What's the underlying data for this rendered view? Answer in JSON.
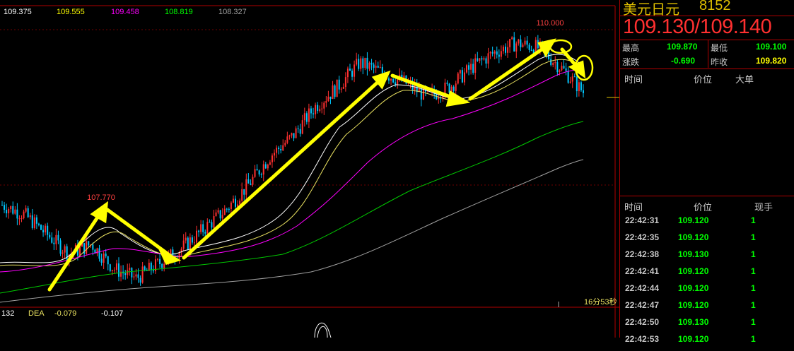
{
  "ma_values": [
    {
      "value": "109.375",
      "color": "#ffffff"
    },
    {
      "value": "109.555",
      "color": "#ffff00"
    },
    {
      "value": "109.458",
      "color": "#ff00ff"
    },
    {
      "value": "108.819",
      "color": "#00ff00"
    },
    {
      "value": "108.327",
      "color": "#a0a0a0"
    }
  ],
  "chart_data": {
    "type": "candlestick",
    "annotations": [
      {
        "label": "107.770",
        "kind": "high-marker"
      },
      {
        "label": "110.000",
        "kind": "high-marker"
      }
    ],
    "price_path": [
      108.35,
      108.25,
      108.05,
      107.85,
      107.95,
      107.7,
      107.6,
      107.75,
      107.9,
      108.1,
      108.3,
      108.55,
      108.85,
      109.05,
      109.35,
      109.55,
      109.8,
      109.7,
      109.6,
      109.45,
      109.55,
      109.75,
      109.9,
      110.0,
      109.95,
      109.75,
      109.5
    ],
    "colors": {
      "up": "#ff3030",
      "down": "#00c8ff",
      "arrow": "#ffff00"
    },
    "timer_label": "16分53秒"
  },
  "macd": {
    "first": "132",
    "dea_label": "DEA",
    "dea_value": "-0.079",
    "third": "-0.107"
  },
  "quote": {
    "name": "美元日元",
    "code": "8152",
    "price": "109.130/109.140",
    "high_label": "最高",
    "high": "109.870",
    "low_label": "最低",
    "low": "109.100",
    "change_label": "涨跌",
    "change": "-0.690",
    "prev_label": "昨收",
    "prev": "109.820"
  },
  "big_orders": {
    "col_time": "时间",
    "col_price": "价位",
    "col_big": "大单"
  },
  "trades": {
    "col_time": "时间",
    "col_price": "价位",
    "col_vol": "现手",
    "rows": [
      {
        "time": "22:42:31",
        "price": "109.120",
        "vol": "1"
      },
      {
        "time": "22:42:35",
        "price": "109.120",
        "vol": "1"
      },
      {
        "time": "22:42:38",
        "price": "109.130",
        "vol": "1"
      },
      {
        "time": "22:42:41",
        "price": "109.120",
        "vol": "1"
      },
      {
        "time": "22:42:44",
        "price": "109.120",
        "vol": "1"
      },
      {
        "time": "22:42:47",
        "price": "109.120",
        "vol": "1"
      },
      {
        "time": "22:42:50",
        "price": "109.130",
        "vol": "1"
      },
      {
        "time": "22:42:53",
        "price": "109.120",
        "vol": "1"
      }
    ]
  }
}
